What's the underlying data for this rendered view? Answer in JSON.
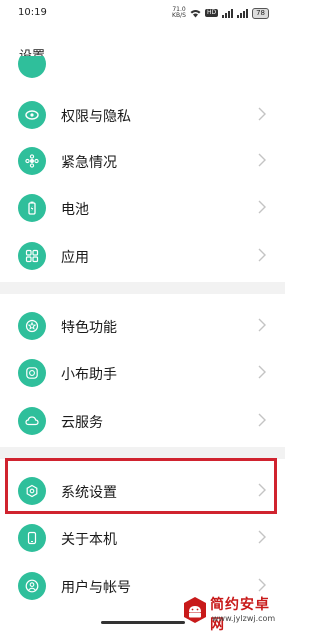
{
  "status_bar": {
    "time": "10:19",
    "net_speed_value": "71.0",
    "net_speed_unit": "KB/S",
    "battery": "78",
    "hd_label": "HD"
  },
  "page": {
    "title": "设置"
  },
  "menu": {
    "group1": [
      {
        "label": "权限与隐私",
        "icon": "shield-eye-icon"
      },
      {
        "label": "紧急情况",
        "icon": "emergency-icon"
      },
      {
        "label": "电池",
        "icon": "battery-icon"
      },
      {
        "label": "应用",
        "icon": "apps-grid-icon"
      }
    ],
    "group2": [
      {
        "label": "特色功能",
        "icon": "star-icon"
      },
      {
        "label": "小布助手",
        "icon": "assistant-icon"
      },
      {
        "label": "云服务",
        "icon": "cloud-icon"
      }
    ],
    "group3": [
      {
        "label": "系统设置",
        "icon": "system-settings-icon"
      },
      {
        "label": "关于本机",
        "icon": "phone-icon"
      },
      {
        "label": "用户与帐号",
        "icon": "user-icon"
      }
    ]
  },
  "watermark": {
    "name": "简约安卓网",
    "url": "www.jylzwj.com"
  },
  "colors": {
    "accent": "#2fbf9b",
    "highlight": "#d0232f"
  }
}
